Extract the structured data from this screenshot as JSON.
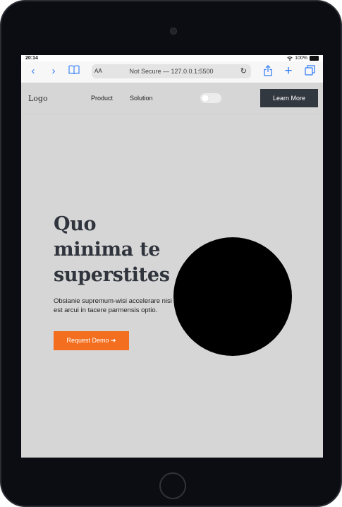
{
  "status_bar": {
    "time": "20:14",
    "battery": "100%"
  },
  "browser": {
    "text_size": "AA",
    "address": "Not Secure — 127.0.0.1:5500",
    "icons": [
      "back-icon",
      "forward-icon",
      "bookmarks-icon",
      "reload-icon",
      "share-icon",
      "new-tab-icon",
      "tabs-icon"
    ]
  },
  "navbar": {
    "logo": "Logo",
    "links": [
      "Product",
      "Solution"
    ],
    "cta": "Learn More"
  },
  "hero": {
    "title": "Quo minima te superstites",
    "text": "Obsianie supremum-wisi accelerare nisi est arcui in tacere parmensis optio.",
    "cta": "Request Demo ➔"
  },
  "colors": {
    "page_bg": "#d6d6d6",
    "accent": "#f36f1f",
    "dark_button": "#323840",
    "link_blue": "#2f7bf6"
  }
}
